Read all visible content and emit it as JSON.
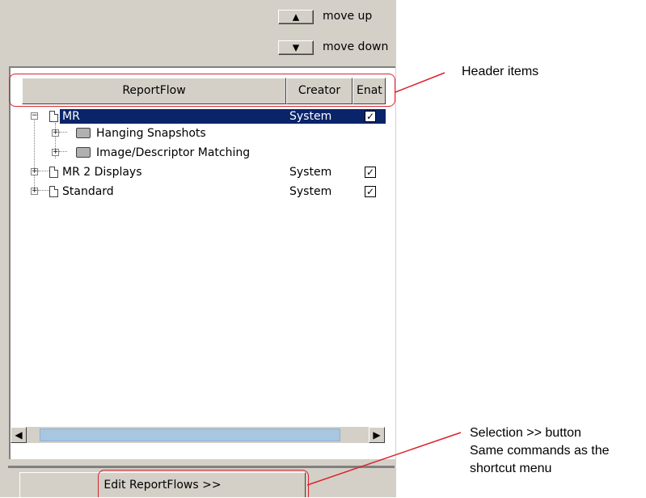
{
  "controls": {
    "move_up": {
      "icon": "triangle-up-icon",
      "glyph": "▲",
      "label": "move up"
    },
    "move_down": {
      "icon": "triangle-down-icon",
      "glyph": "▼",
      "label": "move down"
    }
  },
  "tree": {
    "columns": [
      "ReportFlow",
      "Creator",
      "Enat"
    ],
    "rows": [
      {
        "label": "MR",
        "creator": "System",
        "enabled": true,
        "selected": true,
        "expanded": true,
        "expander": "−",
        "icon": "document-icon"
      },
      {
        "label": "Hanging Snapshots",
        "expander": "+",
        "icon": "folder-icon"
      },
      {
        "label": "Image/Descriptor Matching",
        "expander": "+",
        "icon": "folder-icon"
      },
      {
        "label": "MR 2 Displays",
        "creator": "System",
        "enabled": true,
        "expander": "+",
        "icon": "document-icon"
      },
      {
        "label": "Standard",
        "creator": "System",
        "enabled": true,
        "expander": "+",
        "icon": "document-icon"
      }
    ],
    "checkmark": "✓"
  },
  "scrollbar": {
    "left": "◀",
    "right": "▶"
  },
  "edit_button": {
    "label": "Edit ReportFlows >>"
  },
  "annotations": {
    "header_items": "Header items",
    "selection_line1": "Selection >> button",
    "selection_line2": "Same commands as the",
    "selection_line3": "shortcut menu"
  },
  "colors": {
    "selection": "#0a246a",
    "callout": "#d9232e",
    "panel": "#d4d0c8",
    "scroll_thumb": "#a9c6e0"
  }
}
